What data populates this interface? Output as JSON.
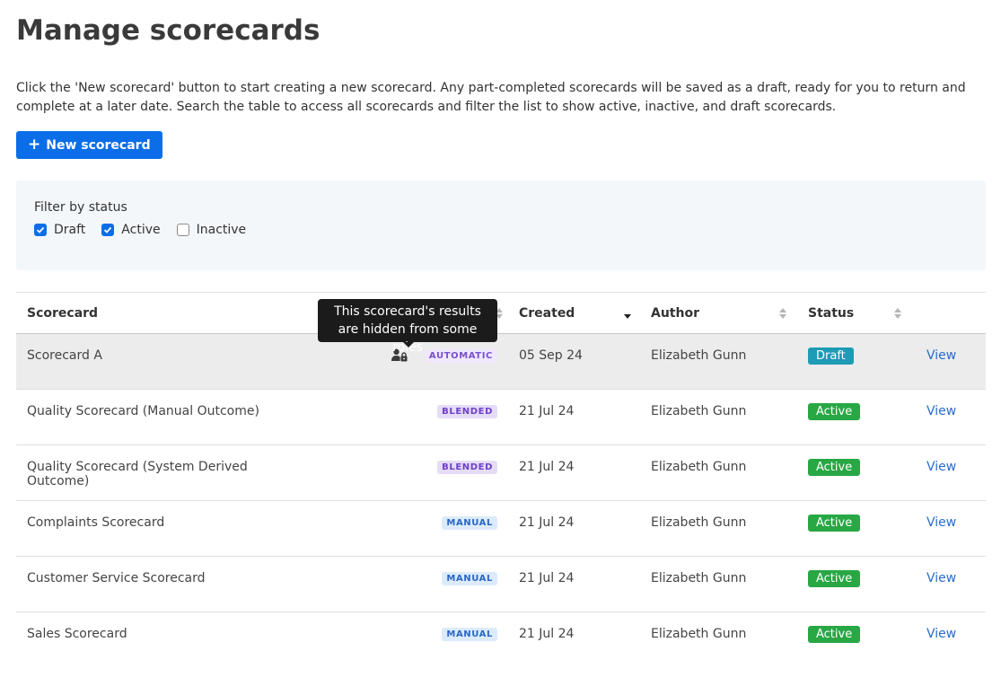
{
  "page": {
    "title": "Manage scorecards",
    "intro": "Click the 'New scorecard' button to start creating a new scorecard. Any part-completed scorecards will be saved as a draft, ready for you to return and complete at a later date. Search the table to access all scorecards and filter the list to show active, inactive, and draft scorecards.",
    "new_button_label": "New scorecard"
  },
  "filter": {
    "label": "Filter by status",
    "options": [
      {
        "label": "Draft",
        "checked": true
      },
      {
        "label": "Active",
        "checked": true
      },
      {
        "label": "Inactive",
        "checked": false
      }
    ]
  },
  "table": {
    "columns": [
      "Scorecard",
      "",
      "Created",
      "Author",
      "Status",
      ""
    ],
    "rows": [
      {
        "name": "Scorecard A",
        "type": "AUTOMATIC",
        "created": "05 Sep 24",
        "author": "Elizabeth Gunn",
        "status": "Draft",
        "action": "View",
        "restricted": true
      },
      {
        "name": "Quality Scorecard (Manual Outcome)",
        "type": "BLENDED",
        "created": "21 Jul 24",
        "author": "Elizabeth Gunn",
        "status": "Active",
        "action": "View"
      },
      {
        "name": "Quality Scorecard (System Derived Outcome)",
        "type": "BLENDED",
        "created": "21 Jul 24",
        "author": "Elizabeth Gunn",
        "status": "Active",
        "action": "View"
      },
      {
        "name": "Complaints Scorecard",
        "type": "MANUAL",
        "created": "21 Jul 24",
        "author": "Elizabeth Gunn",
        "status": "Active",
        "action": "View"
      },
      {
        "name": "Customer Service Scorecard",
        "type": "MANUAL",
        "created": "21 Jul 24",
        "author": "Elizabeth Gunn",
        "status": "Active",
        "action": "View"
      },
      {
        "name": "Sales Scorecard",
        "type": "MANUAL",
        "created": "21 Jul 24",
        "author": "Elizabeth Gunn",
        "status": "Active",
        "action": "View"
      }
    ]
  },
  "tooltip": {
    "text": "This scorecard's results are hidden from some roles"
  },
  "colors": {
    "primary": "#0b6ee8",
    "draft": "#1e9bb5",
    "active": "#28a745",
    "link": "#2a6bcc"
  },
  "icons": {
    "add": "plus-icon",
    "checkbox": "check-icon",
    "restricted": "user-lock-icon",
    "sort": "sort-icon"
  }
}
